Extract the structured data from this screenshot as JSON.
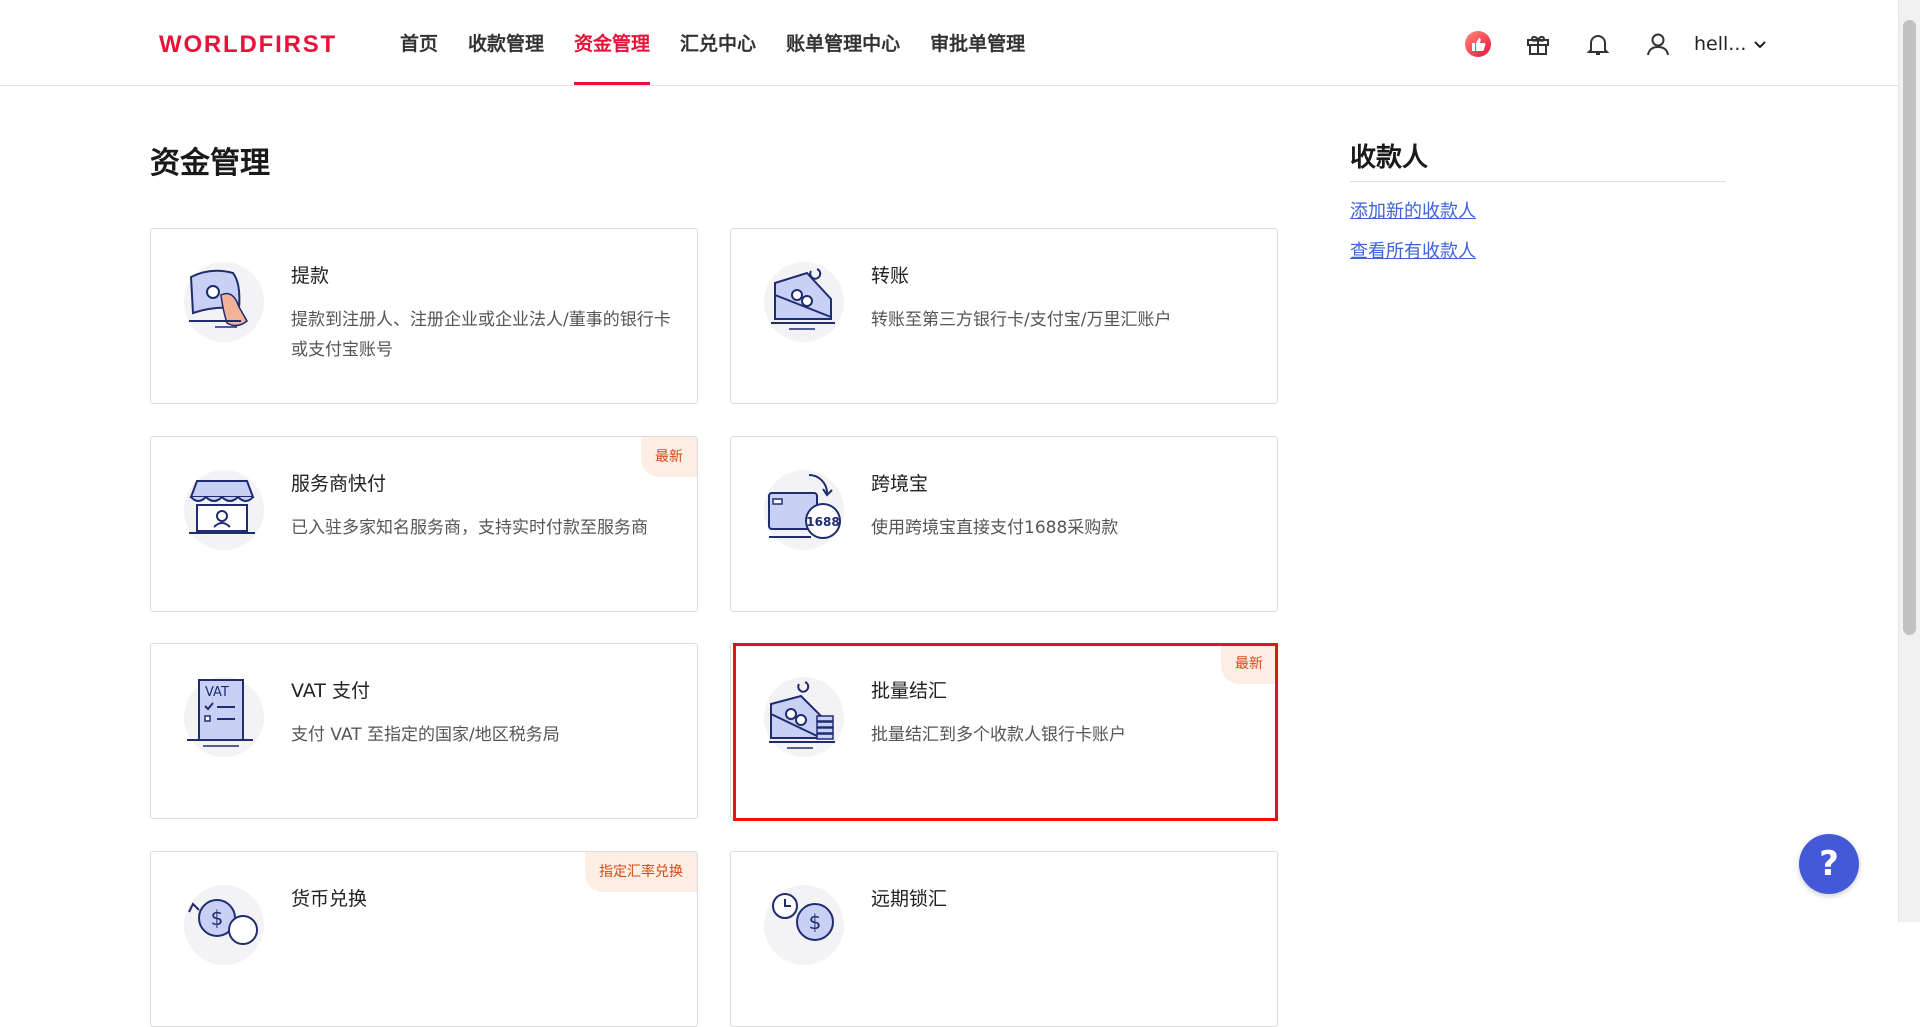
{
  "brand": {
    "logo": "WORLDFIRST",
    "accent_color": "#e8133a"
  },
  "nav": {
    "items": [
      {
        "label": "首页",
        "active": false
      },
      {
        "label": "收款管理",
        "active": false
      },
      {
        "label": "资金管理",
        "active": true
      },
      {
        "label": "汇兑中心",
        "active": false
      },
      {
        "label": "账单管理中心",
        "active": false
      },
      {
        "label": "审批单管理",
        "active": false
      }
    ]
  },
  "header_right": {
    "icons": [
      "thumbs-up-icon",
      "gift-icon",
      "bell-icon",
      "user-icon"
    ],
    "user_name": "hell..."
  },
  "page_title": "资金管理",
  "cards": [
    {
      "title": "提款",
      "desc": "提款到注册人、注册企业或企业法人/董事的银行卡或支付宝账号",
      "badge": "",
      "icon": "withdraw-icon"
    },
    {
      "title": "转账",
      "desc": "转账至第三方银行卡/支付宝/万里汇账户",
      "badge": "",
      "icon": "transfer-icon"
    },
    {
      "title": "服务商快付",
      "desc": "已入驻多家知名服务商，支持实时付款至服务商",
      "badge": "最新",
      "icon": "storefront-icon"
    },
    {
      "title": "跨境宝",
      "desc": "使用跨境宝直接支付1688采购款",
      "badge": "",
      "icon": "wallet-1688-icon"
    },
    {
      "title": "VAT 支付",
      "desc": "支付 VAT 至指定的国家/地区税务局",
      "badge": "",
      "icon": "vat-document-icon"
    },
    {
      "title": "批量结汇",
      "desc": "批量结汇到多个收款人银行卡账户",
      "badge": "最新",
      "icon": "batch-exchange-icon"
    },
    {
      "title": "货币兑换",
      "desc": "",
      "badge": "指定汇率兑换",
      "icon": "currency-exchange-icon"
    },
    {
      "title": "远期锁汇",
      "desc": "",
      "badge": "",
      "icon": "forward-lock-icon"
    }
  ],
  "icon_1688_text": "1688",
  "icon_vat_text": "VAT",
  "side_panel": {
    "title": "收款人",
    "links": [
      "添加新的收款人",
      "查看所有收款人"
    ]
  },
  "help_button": {
    "label": "?",
    "color": "#4359d8"
  }
}
